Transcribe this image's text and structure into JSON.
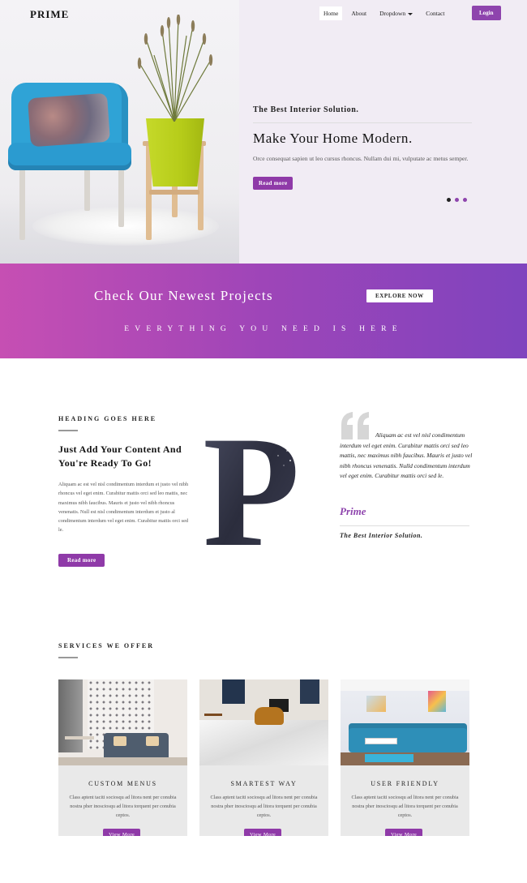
{
  "nav": {
    "logo": "PRIME",
    "links": [
      "Home",
      "About",
      "Dropdown",
      "Contact"
    ],
    "login": "Login"
  },
  "hero": {
    "kicker": "The Best Interior Solution.",
    "title": "Make Your Home Modern.",
    "text": "Orce consequat sapien ut leo cursus rhoncus. Nullam dui mi, vulputate ac metus semper.",
    "button": "Read more",
    "slides": 3,
    "active_slide": 1
  },
  "banner": {
    "title": "Check Our Newest Projects",
    "button": "EXPLORE NOW",
    "subtitle": "EVERYTHING YOU NEED IS HERE"
  },
  "about": {
    "heading": "HEADING GOES HERE",
    "title": "Just Add Your Content And You're Ready To Go!",
    "text": "Aliquam ac est vel nisl condimentum interdum et justo vel nibh rhoncus vel eget enim. Curabitur mattis orci sed leo mattis, nec maximus nibh faucibus. Mauris et justo vel nibh rhoncus venenatis. Null est nisl condimentum interdum et justo al condimentum interdum vel eget enim. Curabitur mattis orci sed le.",
    "button": "Read more",
    "big_letter": "P",
    "quote": "Aliquam ac est vel nisl condimentum interdum vel eget enim. Curabitur mattis orci sed leo mattis, nec maximus nibh faucibus. Mauris et justo vel nibh rhoncus venenatis. Nulld condimentum interdum vel eget enim. Curabitur mattis orci sed le.",
    "quote_author": "Prime",
    "quote_role": "The Best Interior Solution."
  },
  "services": {
    "heading": "SERVICES WE OFFER",
    "cards": [
      {
        "title": "CUSTOM MENUS",
        "text": "Class aptent taciti sociosqu ad litora nent per conubia nostra pher inosciosqu ad litora torquent per conubia ceptos.",
        "button": "View More"
      },
      {
        "title": "SMARTEST WAY",
        "text": "Class aptent taciti sociosqu ad litora nent per conubia nostra pher inosciosqu ad litora torquent per conubia ceptos.",
        "button": "View More"
      },
      {
        "title": "USER FRIENDLY",
        "text": "Class aptent taciti sociosqu ad litora nent per conubia nostra pher inosciosqu ad litora torquent per conubia ceptos.",
        "button": "View More"
      }
    ]
  },
  "colors": {
    "accent": "#8e44ad",
    "banner_start": "#c64fb3",
    "banner_end": "#7f44be",
    "hero_bg": "#f1ecf4",
    "card_bg": "#e9e9e9"
  },
  "icons": [
    "caret-down-icon",
    "quote-icon"
  ]
}
